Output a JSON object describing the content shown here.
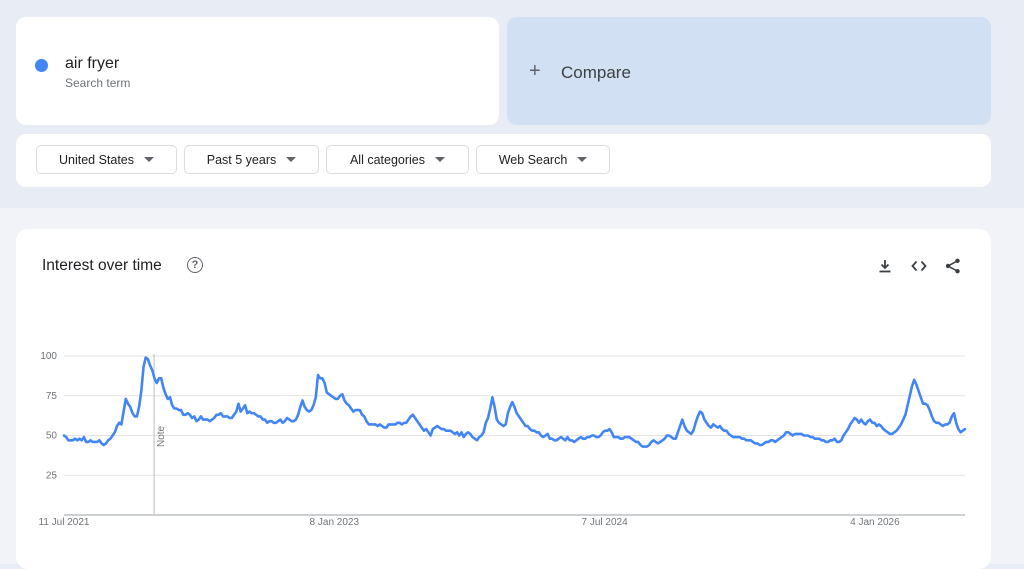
{
  "search_term": {
    "name": "air fryer",
    "subtitle": "Search term",
    "color": "#4285f4"
  },
  "compare": {
    "plus": "+",
    "label": "Compare"
  },
  "filters": [
    {
      "label": "United States"
    },
    {
      "label": "Past 5 years"
    },
    {
      "label": "All categories"
    },
    {
      "label": "Web Search"
    }
  ],
  "chart_card": {
    "title": "Interest over time",
    "help_glyph": "?",
    "note_label": "Note",
    "icons": [
      "download-icon",
      "embed-icon",
      "share-icon"
    ]
  },
  "chart_data": {
    "type": "line",
    "title": "Interest over time",
    "x_tick_labels": [
      "11 Jul 2021",
      "8 Jan 2023",
      "7 Jul 2024",
      "4 Jan 2026"
    ],
    "x_start": "2021-07-11",
    "x_end": "2026-07-05",
    "y_tick_labels": [
      "100",
      "75",
      "50",
      "25"
    ],
    "ylim": [
      0,
      100
    ],
    "grid": true,
    "note": {
      "date": "2022-01-09",
      "label": "Note"
    },
    "series": [
      {
        "color": "#4285f4",
        "values": [
          50,
          49,
          47,
          47,
          47,
          48,
          47,
          48,
          47,
          49,
          46,
          46,
          47,
          46,
          46,
          46,
          47,
          45,
          44,
          45,
          47,
          48,
          50,
          52,
          56,
          58,
          57,
          65,
          73,
          70,
          68,
          64,
          62,
          62,
          68,
          78,
          93,
          99,
          98,
          94,
          91,
          86,
          83,
          86,
          86,
          80,
          76,
          73,
          74,
          69,
          67,
          67,
          66,
          66,
          63,
          63,
          64,
          63,
          61,
          62,
          59,
          60,
          62,
          60,
          60,
          60,
          59,
          60,
          61,
          63,
          63,
          64,
          62,
          62,
          62,
          61,
          61,
          63,
          65,
          70,
          65,
          67,
          69,
          64,
          65,
          64,
          64,
          63,
          62,
          62,
          60,
          60,
          58,
          59,
          59,
          58,
          58,
          59,
          60,
          58,
          59,
          61,
          60,
          59,
          59,
          60,
          63,
          68,
          72,
          68,
          66,
          65,
          66,
          69,
          74,
          88,
          86,
          86,
          83,
          77,
          76,
          75,
          74,
          73,
          73,
          75,
          76,
          72,
          70,
          69,
          67,
          65,
          66,
          66,
          66,
          63,
          62,
          59,
          57,
          57,
          57,
          57,
          56,
          57,
          56,
          55,
          55,
          57,
          57,
          57,
          57,
          58,
          58,
          57,
          58,
          58,
          60,
          62,
          63,
          61,
          59,
          57,
          55,
          53,
          54,
          52,
          50,
          54,
          55,
          56,
          55,
          54,
          54,
          53,
          53,
          53,
          52,
          51,
          52,
          50,
          52,
          49,
          51,
          52,
          51,
          49,
          48,
          47,
          49,
          50,
          52,
          58,
          61,
          67,
          74,
          68,
          60,
          58,
          57,
          56,
          57,
          64,
          68,
          71,
          68,
          64,
          62,
          60,
          58,
          56,
          56,
          54,
          53,
          53,
          52,
          52,
          50,
          49,
          50,
          51,
          48,
          48,
          47,
          47,
          48,
          49,
          48,
          47,
          49,
          47,
          47,
          46,
          47,
          48,
          49,
          48,
          48,
          49,
          49,
          50,
          50,
          49,
          49,
          50,
          52,
          53,
          53,
          54,
          52,
          49,
          49,
          49,
          48,
          48,
          49,
          49,
          49,
          48,
          47,
          46,
          46,
          44,
          43,
          43,
          43,
          44,
          46,
          47,
          46,
          45,
          46,
          47,
          48,
          50,
          50,
          49,
          48,
          48,
          52,
          56,
          60,
          56,
          53,
          52,
          51,
          53,
          58,
          62,
          65,
          64,
          60,
          58,
          56,
          55,
          57,
          56,
          55,
          56,
          54,
          53,
          53,
          51,
          50,
          49,
          49,
          49,
          49,
          48,
          48,
          47,
          47,
          47,
          46,
          45,
          45,
          44,
          44,
          45,
          46,
          46,
          47,
          47,
          46,
          47,
          48,
          49,
          50,
          52,
          52,
          51,
          50,
          51,
          51,
          51,
          51,
          50,
          50,
          50,
          49,
          49,
          48,
          48,
          48,
          47,
          47,
          46,
          46,
          47,
          47,
          48,
          46,
          46,
          47,
          50,
          52,
          54,
          57,
          59,
          61,
          60,
          58,
          60,
          58,
          57,
          59,
          60,
          58,
          58,
          56,
          57,
          56,
          54,
          53,
          52,
          51,
          51,
          52,
          53,
          55,
          57,
          60,
          63,
          69,
          75,
          81,
          85,
          82,
          78,
          74,
          70,
          70,
          69,
          66,
          62,
          59,
          58,
          58,
          57,
          56,
          57,
          57,
          58,
          62,
          64,
          58,
          54,
          52,
          53,
          54
        ]
      }
    ]
  }
}
